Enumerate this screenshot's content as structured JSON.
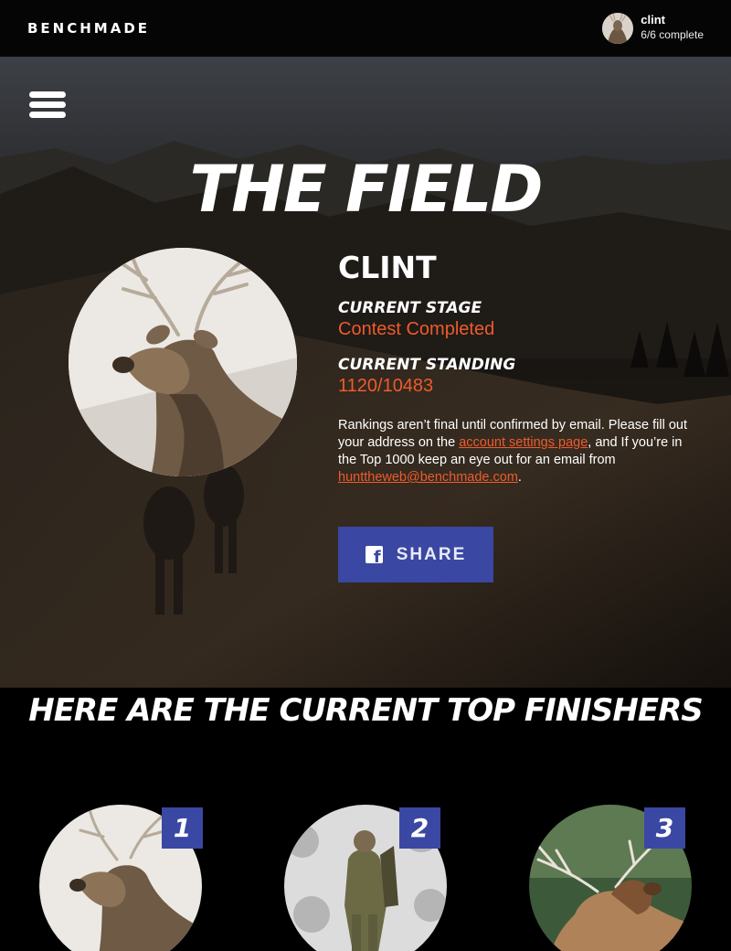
{
  "header": {
    "brand": "BENCHMADE",
    "user_name": "clint",
    "user_progress": "6/6 complete"
  },
  "hero": {
    "title": "THE FIELD",
    "player_name": "CLINT",
    "stage_label": "CURRENT STAGE",
    "stage_value": "Contest Completed",
    "standing_label": "CURRENT STANDING",
    "standing_value": "1120/10483",
    "note_part1": "Rankings aren’t final until confirmed by email. Please fill out your address on the ",
    "account_link": "account settings page",
    "note_part2": ", and If you’re in the Top 1000 keep an eye out for an email from ",
    "email_link": "hunttheweb@benchmade.com",
    "note_part3": ".",
    "share_label": "SHARE"
  },
  "finishers": {
    "title": "HERE ARE THE CURRENT TOP FINISHERS",
    "items": [
      {
        "rank": "1",
        "image": "elk-portrait"
      },
      {
        "rank": "2",
        "image": "hunter-in-snow"
      },
      {
        "rank": "3",
        "image": "bull-elk-bugling"
      }
    ]
  },
  "colors": {
    "accent_orange": "#ee5b2c",
    "accent_blue": "#3a47a3",
    "background": "#000000"
  },
  "icons": [
    "menu-icon",
    "facebook-icon",
    "benchmade-butterfly-icon"
  ]
}
